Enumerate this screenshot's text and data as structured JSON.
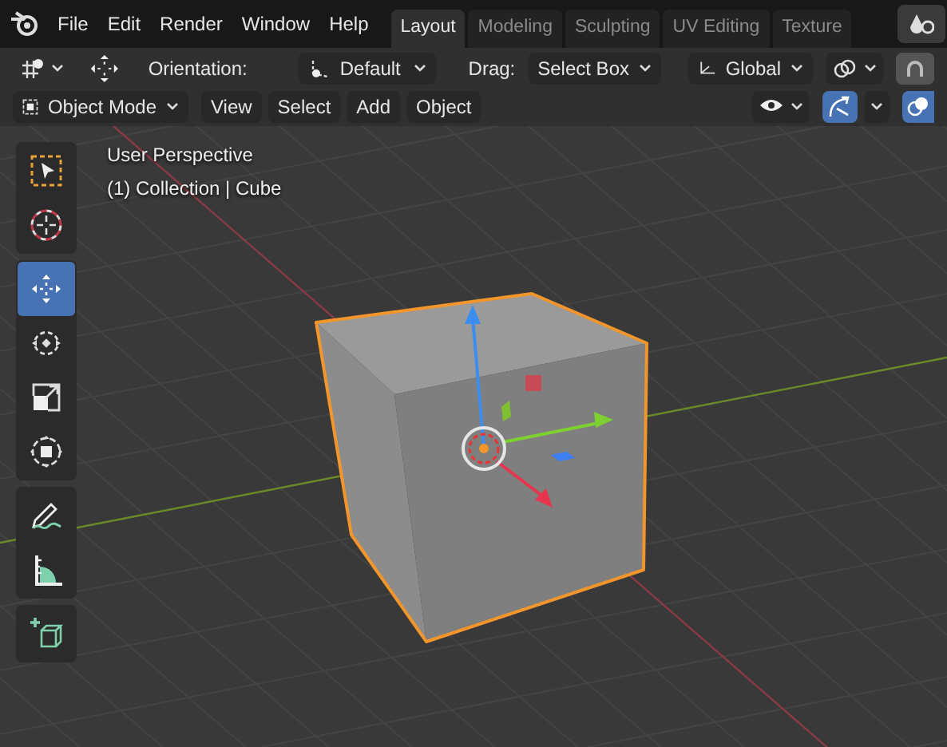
{
  "menu": [
    "File",
    "Edit",
    "Render",
    "Window",
    "Help"
  ],
  "workspace_tabs": [
    {
      "label": "Layout",
      "selected": true
    },
    {
      "label": "Modeling",
      "selected": false
    },
    {
      "label": "Sculpting",
      "selected": false
    },
    {
      "label": "UV Editing",
      "selected": false
    },
    {
      "label": "Texture",
      "selected": false
    }
  ],
  "tool_header": {
    "orientation_label": "Orientation:",
    "orientation": "Default",
    "drag_label": "Drag:",
    "drag": "Select Box",
    "transform_orientation": "Global",
    "snap_on": false
  },
  "viewport_header": {
    "mode": "Object Mode",
    "menus": [
      "View",
      "Select",
      "Add",
      "Object"
    ],
    "gizmos_on": true,
    "overlays_on": true
  },
  "toolbar": {
    "groups": [
      [
        {
          "kind": "select_box",
          "selected": false
        },
        {
          "kind": "cursor",
          "selected": false
        }
      ],
      [
        {
          "kind": "move",
          "selected": true
        },
        {
          "kind": "rotate",
          "selected": false
        },
        {
          "kind": "scale",
          "selected": false
        },
        {
          "kind": "transform",
          "selected": false
        }
      ],
      [
        {
          "kind": "annotate",
          "selected": false
        },
        {
          "kind": "measure",
          "selected": false
        }
      ],
      [
        {
          "kind": "add_cube",
          "selected": false
        }
      ]
    ]
  },
  "viewport_info": [
    "User Perspective",
    "(1) Collection | Cube"
  ]
}
